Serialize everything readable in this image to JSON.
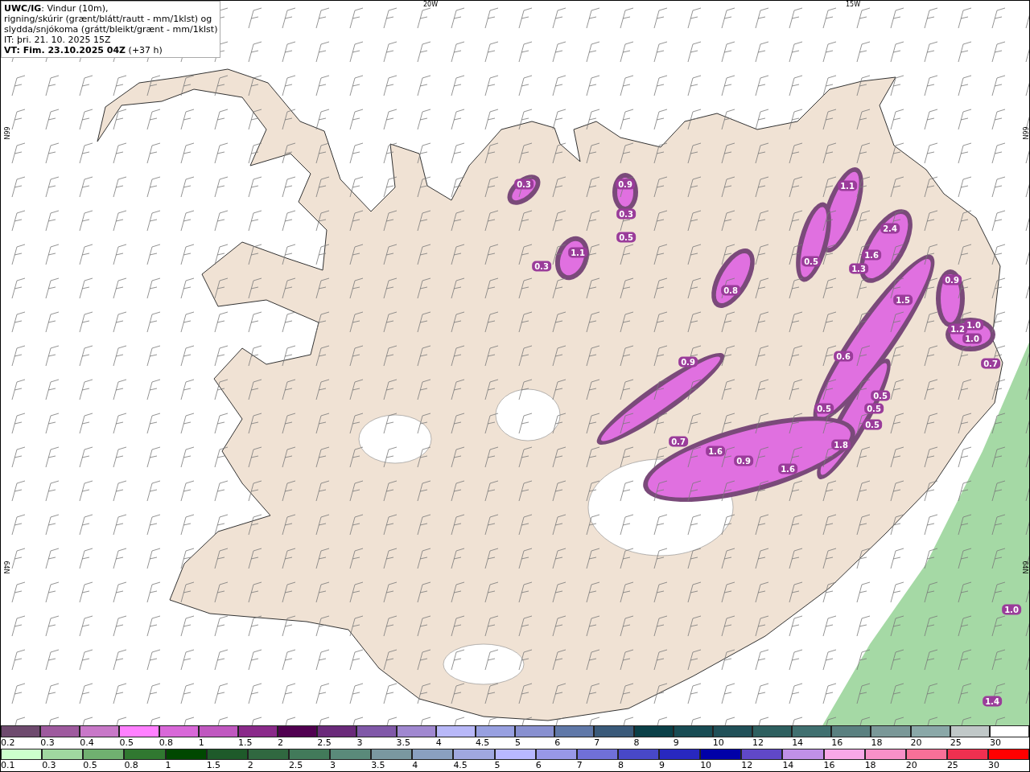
{
  "legend": {
    "title": "UWC/IG",
    "lines": [
      ": Vindur (10m),",
      "rigning/skúrir (grænt/blátt/rautt - mm/1klst) og",
      "slydda/snjókoma (grátt/bleikt/grænt - mm/1klst)",
      "IT: þri. 21. 10. 2025 15Z"
    ],
    "valid_time": "VT: Fim. 23.10.2025 04Z",
    "lead": "(+37 h)"
  },
  "axis_labels": {
    "top": [
      "20W",
      "15W"
    ],
    "left": [
      "66N",
      "64N"
    ],
    "right": [
      "66N",
      "64N"
    ]
  },
  "map_values": [
    "0.3",
    "0.9",
    "1.1",
    "2.4",
    "1.6",
    "1.3",
    "0.5",
    "0.8",
    "1.5",
    "0.9",
    "1.2",
    "1.0",
    "1.0",
    "0.7",
    "0.6",
    "0.5",
    "0.5",
    "0.5",
    "0.5",
    "1.8",
    "1.6",
    "0.9",
    "1.6",
    "0.7",
    "0.9",
    "0.3",
    "0.5",
    "1.1",
    "0.3",
    "1.0",
    "1.4"
  ],
  "colorbars": [
    {
      "kind": "snow",
      "cells": [
        {
          "label": "0.2",
          "color": "#6e4a6e"
        },
        {
          "label": "0.3",
          "color": "#9e5a9e"
        },
        {
          "label": "0.4",
          "color": "#c878c8"
        },
        {
          "label": "0.5",
          "color": "#ff80ff"
        },
        {
          "label": "0.8",
          "color": "#d868d8"
        },
        {
          "label": "1",
          "color": "#c058c0"
        },
        {
          "label": "1.5",
          "color": "#8a2a8a"
        },
        {
          "label": "2",
          "color": "#500050"
        },
        {
          "label": "2.5",
          "color": "#6a2a7a"
        },
        {
          "label": "3",
          "color": "#8058a8"
        },
        {
          "label": "3.5",
          "color": "#a088d0"
        },
        {
          "label": "4",
          "color": "#b8b8f8"
        },
        {
          "label": "4.5",
          "color": "#98a0e0"
        },
        {
          "label": "5",
          "color": "#8890d0"
        },
        {
          "label": "6",
          "color": "#6078a8"
        },
        {
          "label": "7",
          "color": "#3a5a7a"
        },
        {
          "label": "8",
          "color": "#0a4048"
        },
        {
          "label": "9",
          "color": "#184c54"
        },
        {
          "label": "10",
          "color": "#205058"
        },
        {
          "label": "12",
          "color": "#2e6060"
        },
        {
          "label": "14",
          "color": "#407070"
        },
        {
          "label": "16",
          "color": "#5a8080"
        },
        {
          "label": "18",
          "color": "#7a9898"
        },
        {
          "label": "20",
          "color": "#8aa8a8"
        },
        {
          "label": "25",
          "color": "#c0c8c8"
        },
        {
          "label": "30",
          "color": "#ffffff"
        }
      ]
    },
    {
      "kind": "rain",
      "cells": [
        {
          "label": "0.1",
          "color": "#ccffcc"
        },
        {
          "label": "0.3",
          "color": "#a0d8a0"
        },
        {
          "label": "0.5",
          "color": "#70b070"
        },
        {
          "label": "0.8",
          "color": "#307830"
        },
        {
          "label": "1",
          "color": "#004800"
        },
        {
          "label": "1.5",
          "color": "#1e5a2a"
        },
        {
          "label": "2",
          "color": "#306840"
        },
        {
          "label": "2.5",
          "color": "#427a5a"
        },
        {
          "label": "3",
          "color": "#5a8a7a"
        },
        {
          "label": "3.5",
          "color": "#7a98a0"
        },
        {
          "label": "4",
          "color": "#8aa0c0"
        },
        {
          "label": "4.5",
          "color": "#a0a8e0"
        },
        {
          "label": "5",
          "color": "#b8b8ff"
        },
        {
          "label": "6",
          "color": "#9898e8"
        },
        {
          "label": "7",
          "color": "#7070d8"
        },
        {
          "label": "8",
          "color": "#4848c8"
        },
        {
          "label": "9",
          "color": "#2828c0"
        },
        {
          "label": "10",
          "color": "#0000a8"
        },
        {
          "label": "12",
          "color": "#6048c8"
        },
        {
          "label": "14",
          "color": "#c090e8"
        },
        {
          "label": "16",
          "color": "#f8a8e8"
        },
        {
          "label": "18",
          "color": "#f890c8"
        },
        {
          "label": "20",
          "color": "#f87098"
        },
        {
          "label": "25",
          "color": "#f03050"
        },
        {
          "label": "30",
          "color": "#ff0000"
        }
      ]
    }
  ]
}
